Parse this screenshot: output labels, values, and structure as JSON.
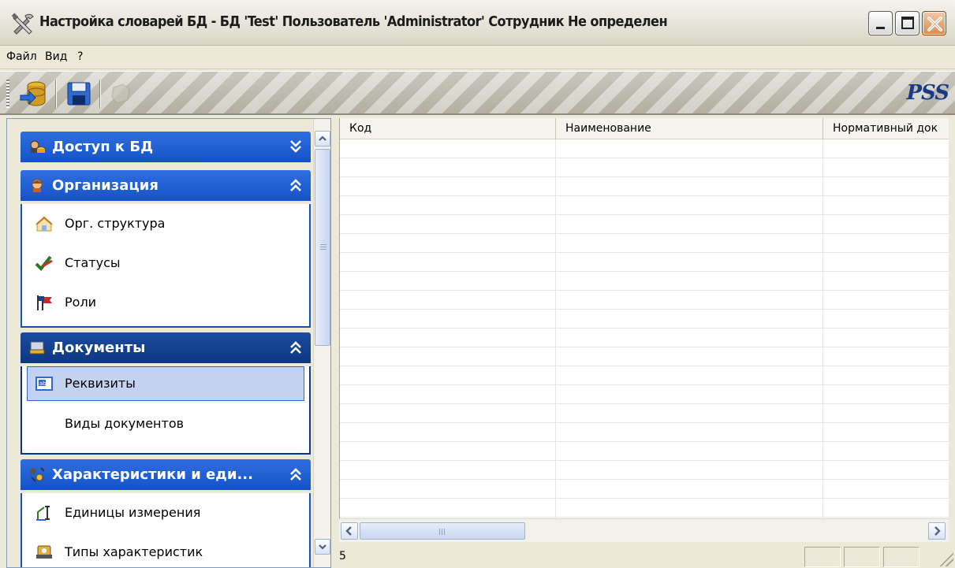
{
  "window": {
    "title": "Настройка словарей БД - БД 'Test' Пользователь 'Administrator' Сотрудник Не определен"
  },
  "menu": [
    "Файл",
    "Вид",
    "?"
  ],
  "toolbar": {
    "brand": "PSS",
    "buttons": [
      "database-connect-icon",
      "save-icon",
      "disabled-tool-icon"
    ]
  },
  "nav": {
    "groups": [
      {
        "label": "Доступ к БД",
        "icon": "db-access-icon",
        "expanded": false,
        "items": []
      },
      {
        "label": "Организация",
        "icon": "organization-icon",
        "expanded": true,
        "items": [
          {
            "label": "Орг. структура",
            "icon": "org-structure-icon"
          },
          {
            "label": "Статусы",
            "icon": "checkmark-icon"
          },
          {
            "label": "Роли",
            "icon": "flag-icon"
          }
        ]
      },
      {
        "label": "Документы",
        "icon": "documents-icon",
        "expanded": true,
        "active": true,
        "items": [
          {
            "label": "Реквизиты",
            "icon": "text-field-icon",
            "selected": true
          },
          {
            "label": "Виды документов",
            "icon": ""
          }
        ]
      },
      {
        "label": "Характеристики и еди...",
        "icon": "characteristics-icon",
        "expanded": true,
        "items": [
          {
            "label": "Единицы измерения",
            "icon": "measure-icon"
          },
          {
            "label": "Типы характеристик",
            "icon": "characteristic-type-icon"
          }
        ]
      }
    ]
  },
  "grid": {
    "columns": [
      "Код",
      "Наименование",
      "Нормативный док"
    ],
    "rows": []
  },
  "status": {
    "count": "5"
  },
  "colors": {
    "group_header": "#1552c7",
    "selected_item": "#c1d3f0",
    "brand": "#1a3a84"
  }
}
